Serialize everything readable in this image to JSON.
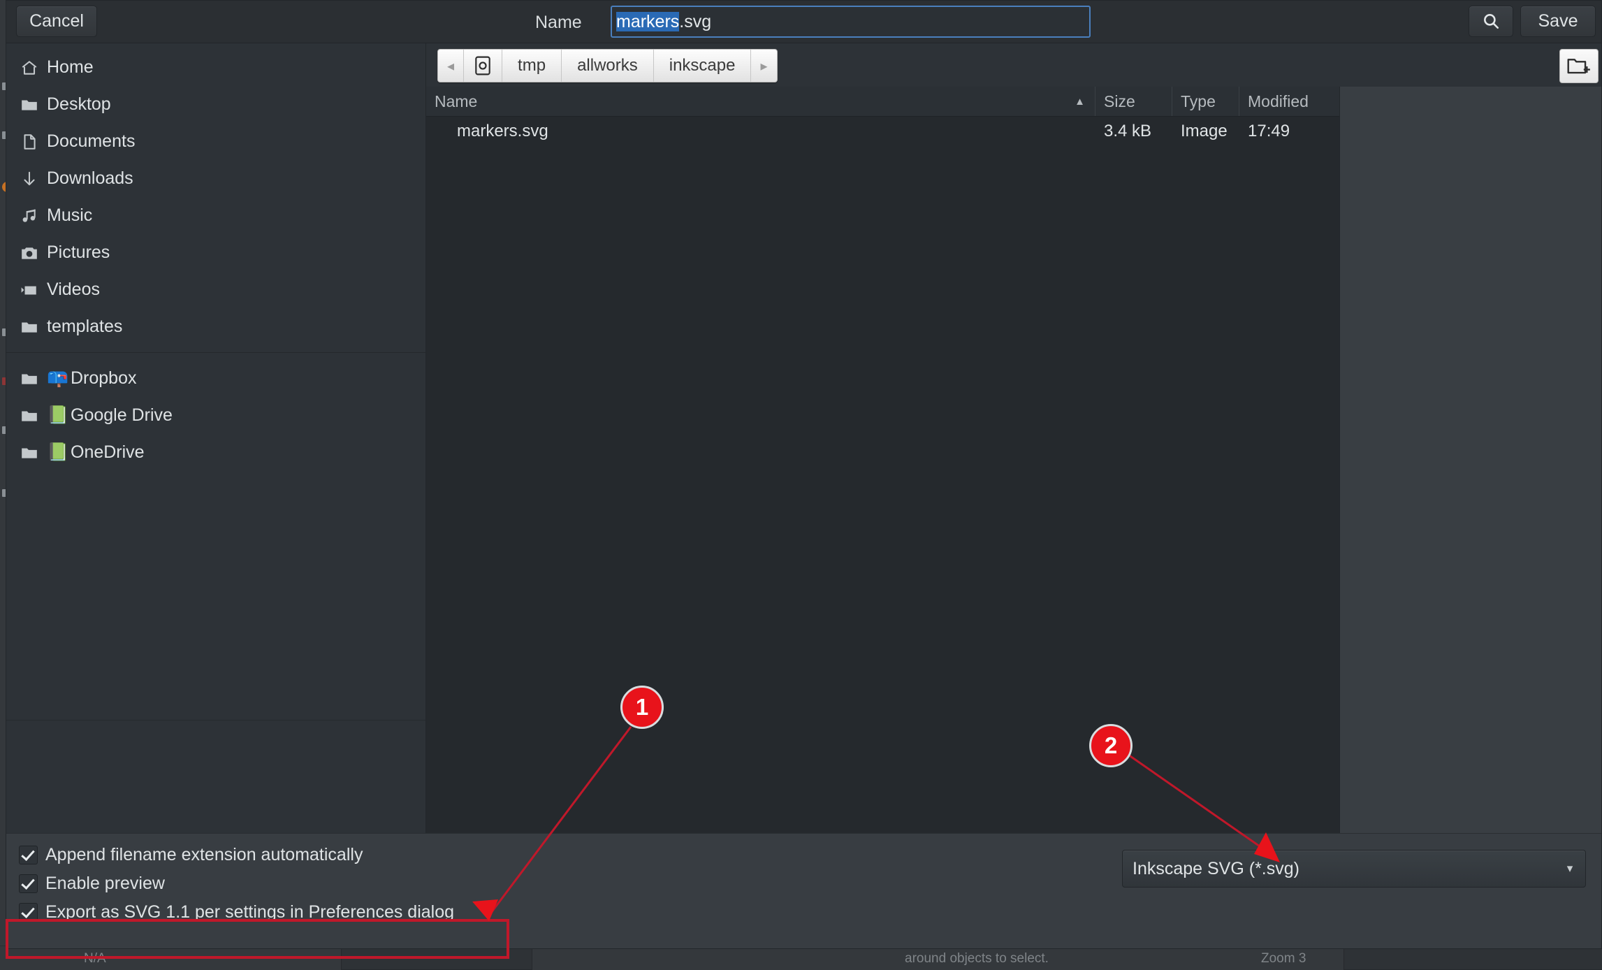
{
  "dialog": {
    "header": {
      "cancel_label": "Cancel",
      "name_label": "Name",
      "filename_selected": "markers",
      "filename_rest": ".svg",
      "search_icon": "search-icon",
      "save_label": "Save"
    },
    "sidebar": {
      "places": [
        {
          "label": "Home",
          "icon": "home-icon"
        },
        {
          "label": "Desktop",
          "icon": "folder-icon"
        },
        {
          "label": "Documents",
          "icon": "document-icon"
        },
        {
          "label": "Downloads",
          "icon": "download-arrow-icon"
        },
        {
          "label": "Music",
          "icon": "music-note-icon"
        },
        {
          "label": "Pictures",
          "icon": "camera-icon"
        },
        {
          "label": "Videos",
          "icon": "video-camera-icon"
        },
        {
          "label": "templates",
          "icon": "folder-icon"
        }
      ],
      "bookmarks": [
        {
          "label": "Dropbox",
          "icon": "folder-icon",
          "badge": "📪"
        },
        {
          "label": "Google Drive",
          "icon": "folder-icon",
          "badge": "📗"
        },
        {
          "label": "OneDrive",
          "icon": "folder-icon",
          "badge": "📗"
        }
      ]
    },
    "pathbar": {
      "back_arrow": "◂",
      "root_icon": "device-icon",
      "crumbs": [
        "tmp",
        "allworks",
        "inkscape"
      ],
      "forward_arrow": "▸",
      "new_folder_icon": "new-folder-icon"
    },
    "filelist": {
      "columns": [
        {
          "key": "name",
          "label": "Name",
          "sort": "▲"
        },
        {
          "key": "size",
          "label": "Size",
          "sort": ""
        },
        {
          "key": "type",
          "label": "Type",
          "sort": ""
        },
        {
          "key": "modified",
          "label": "Modified",
          "sort": ""
        }
      ],
      "rows": [
        {
          "name": "markers.svg",
          "size": "3.4 kB",
          "type": "Image",
          "modified": "17:49"
        }
      ]
    },
    "footer": {
      "checkboxes": [
        {
          "label": "Append filename extension automatically",
          "checked": true
        },
        {
          "label": "Enable preview",
          "checked": true
        },
        {
          "label": "Export as SVG 1.1 per settings in Preferences dialog",
          "checked": true,
          "highlighted": true
        }
      ],
      "filetype": {
        "value": "Inkscape SVG (*.svg)",
        "caret": "▾"
      }
    }
  },
  "annotations": {
    "accent_color": "#e8131b",
    "badges": [
      {
        "number": "1",
        "target": "export-as-svg11-checkbox"
      },
      {
        "number": "2",
        "target": "filetype-select"
      }
    ]
  },
  "app_statusbar": {
    "left_value": "N/A",
    "center_hint": "around objects to select.",
    "zoom_label": "Zoom 3"
  }
}
